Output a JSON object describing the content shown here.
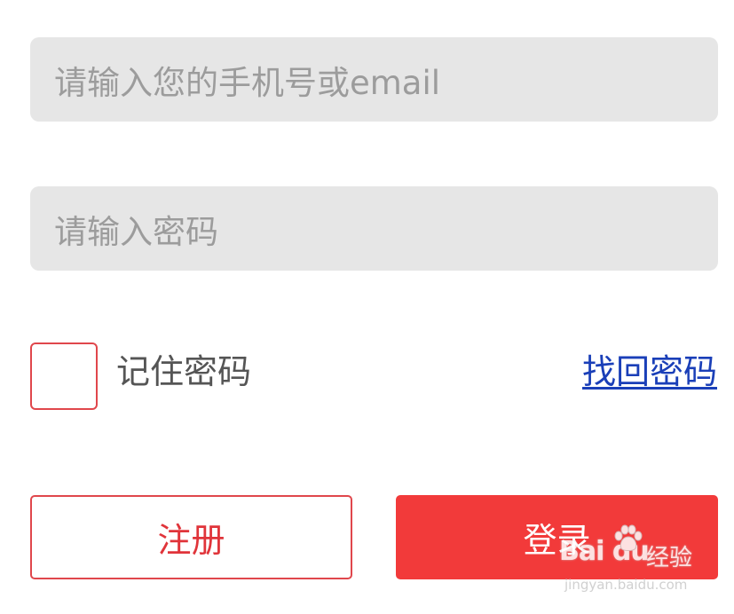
{
  "login_form": {
    "phone_placeholder": "请输入您的手机号或email",
    "password_placeholder": "请输入密码",
    "remember_label": "记住密码",
    "remember_checked": false,
    "forgot_link": "找回密码",
    "register_label": "注册",
    "login_label": "登录"
  },
  "colors": {
    "accent_red": "#f23a3a",
    "input_bg": "#e6e6e6",
    "link_blue": "#1a3fb8"
  },
  "watermark": {
    "brand": "Bai du",
    "suffix": "经验",
    "url": "jingyan.baidu.com",
    "icon": "baidu-paw-icon"
  }
}
